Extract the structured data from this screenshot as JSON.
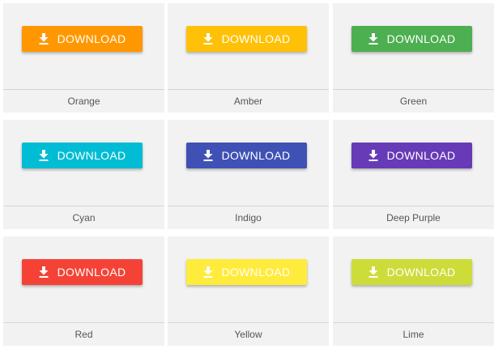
{
  "button_label": "DOWNLOAD",
  "button_icon": "download-icon",
  "cards": [
    {
      "name": "Orange",
      "color": "#ff9800"
    },
    {
      "name": "Amber",
      "color": "#ffc107"
    },
    {
      "name": "Green",
      "color": "#4caf50"
    },
    {
      "name": "Cyan",
      "color": "#00bcd4"
    },
    {
      "name": "Indigo",
      "color": "#3f51b5"
    },
    {
      "name": "Deep Purple",
      "color": "#673ab7"
    },
    {
      "name": "Red",
      "color": "#f44336"
    },
    {
      "name": "Yellow",
      "color": "#ffeb3b"
    },
    {
      "name": "Lime",
      "color": "#cddc39"
    }
  ]
}
